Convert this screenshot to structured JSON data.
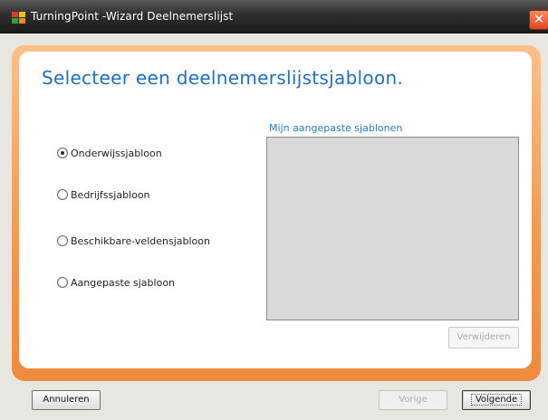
{
  "window": {
    "title": "TurningPoint -Wizard Deelnemerslijst",
    "close_glyph": "✕"
  },
  "page": {
    "heading": "Selecteer een deelnemerslijstsjabloon."
  },
  "options": [
    {
      "label": "Onderwijssjabloon",
      "checked": true
    },
    {
      "label": "Bedrijfssjabloon",
      "checked": false
    },
    {
      "label": "Beschikbare-veldensjabloon",
      "checked": false
    },
    {
      "label": "Aangepaste sjabloon",
      "checked": false
    }
  ],
  "custom_templates": {
    "label": "Mijn aangepaste sjablonen",
    "items": [],
    "delete_label": "Verwijderen"
  },
  "footer": {
    "cancel_label": "Annuleren",
    "back_label": "Vorige",
    "next_label": "Volgende"
  },
  "colors": {
    "heading": "#1f6fbf",
    "accent_orange": "#f29a52"
  }
}
